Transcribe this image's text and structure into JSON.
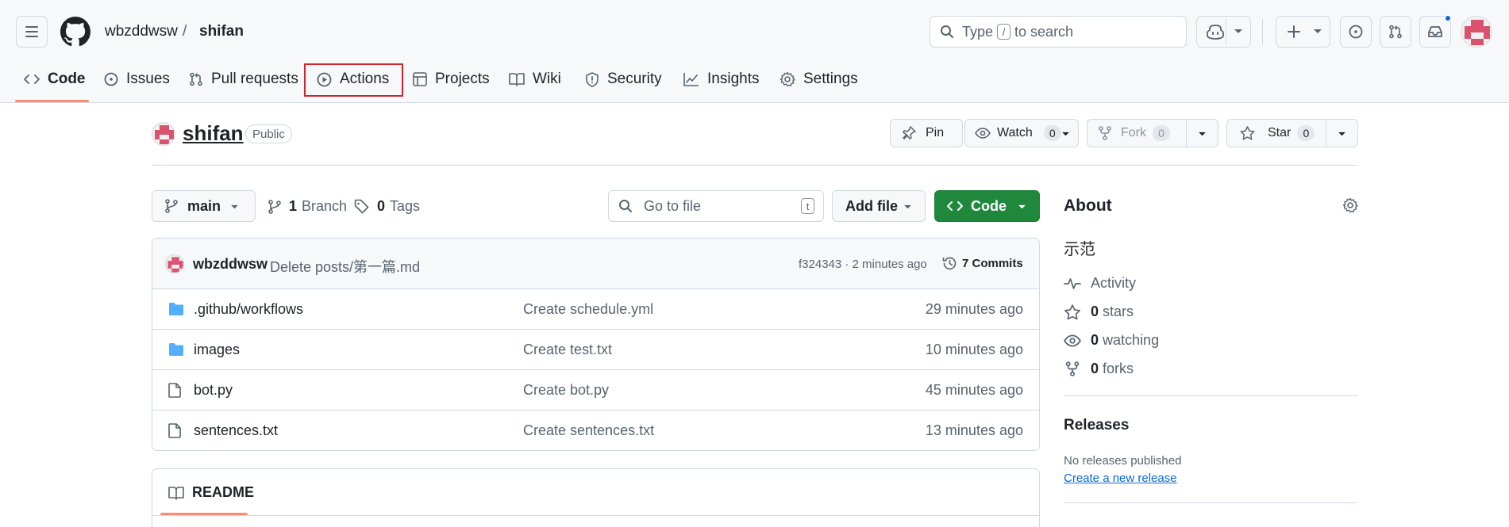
{
  "header": {
    "owner": "wbzddwsw",
    "separator": "/",
    "repo": "shifan",
    "search": {
      "prefix": "Type",
      "key": "/",
      "suffix": "to search"
    }
  },
  "tabs": [
    {
      "label": "Code",
      "icon": "code-icon"
    },
    {
      "label": "Issues",
      "icon": "issue-opened-icon"
    },
    {
      "label": "Pull requests",
      "icon": "git-pull-request-icon"
    },
    {
      "label": "Actions",
      "icon": "play-icon"
    },
    {
      "label": "Projects",
      "icon": "table-icon"
    },
    {
      "label": "Wiki",
      "icon": "book-icon"
    },
    {
      "label": "Security",
      "icon": "shield-icon"
    },
    {
      "label": "Insights",
      "icon": "graph-icon"
    },
    {
      "label": "Settings",
      "icon": "gear-icon"
    }
  ],
  "repo": {
    "name": "shifan",
    "visibility": "Public",
    "pin_label": "Pin",
    "watch_label": "Watch",
    "watch_count": "0",
    "fork_label": "Fork",
    "fork_count": "0",
    "star_label": "Star",
    "star_count": "0"
  },
  "toolbar": {
    "branch": "main",
    "branch_count": "1",
    "branch_label": "Branch",
    "tag_count": "0",
    "tag_label": "Tags",
    "goto_placeholder": "Go to file",
    "goto_key": "t",
    "add_file_label": "Add file",
    "code_label": "Code"
  },
  "commit": {
    "author": "wbzddwsw",
    "message": "Delete posts/第一篇.md",
    "meta": "f324343 · 2 minutes ago",
    "commits_label": "7 Commits"
  },
  "files": [
    {
      "type": "folder",
      "name": ".github/workflows",
      "message": "Create schedule.yml",
      "time": "29 minutes ago"
    },
    {
      "type": "folder",
      "name": "images",
      "message": "Create test.txt",
      "time": "10 minutes ago"
    },
    {
      "type": "file",
      "name": "bot.py",
      "message": "Create bot.py",
      "time": "45 minutes ago"
    },
    {
      "type": "file",
      "name": "sentences.txt",
      "message": "Create sentences.txt",
      "time": "13 minutes ago"
    }
  ],
  "readme": {
    "label": "README"
  },
  "about": {
    "title": "About",
    "description": "示范",
    "activity_label": "Activity",
    "stars_count": "0",
    "stars_label": "stars",
    "watching_count": "0",
    "watching_label": "watching",
    "forks_count": "0",
    "forks_label": "forks"
  },
  "releases": {
    "title": "Releases",
    "none_text": "No releases published",
    "create_link": "Create a new release"
  },
  "colors": {
    "accent_tab": "#fd8c73",
    "primary_green": "#1f883d",
    "link_blue": "#0969da",
    "folder_blue": "#54aeff",
    "highlight_red": "#d0252e"
  }
}
